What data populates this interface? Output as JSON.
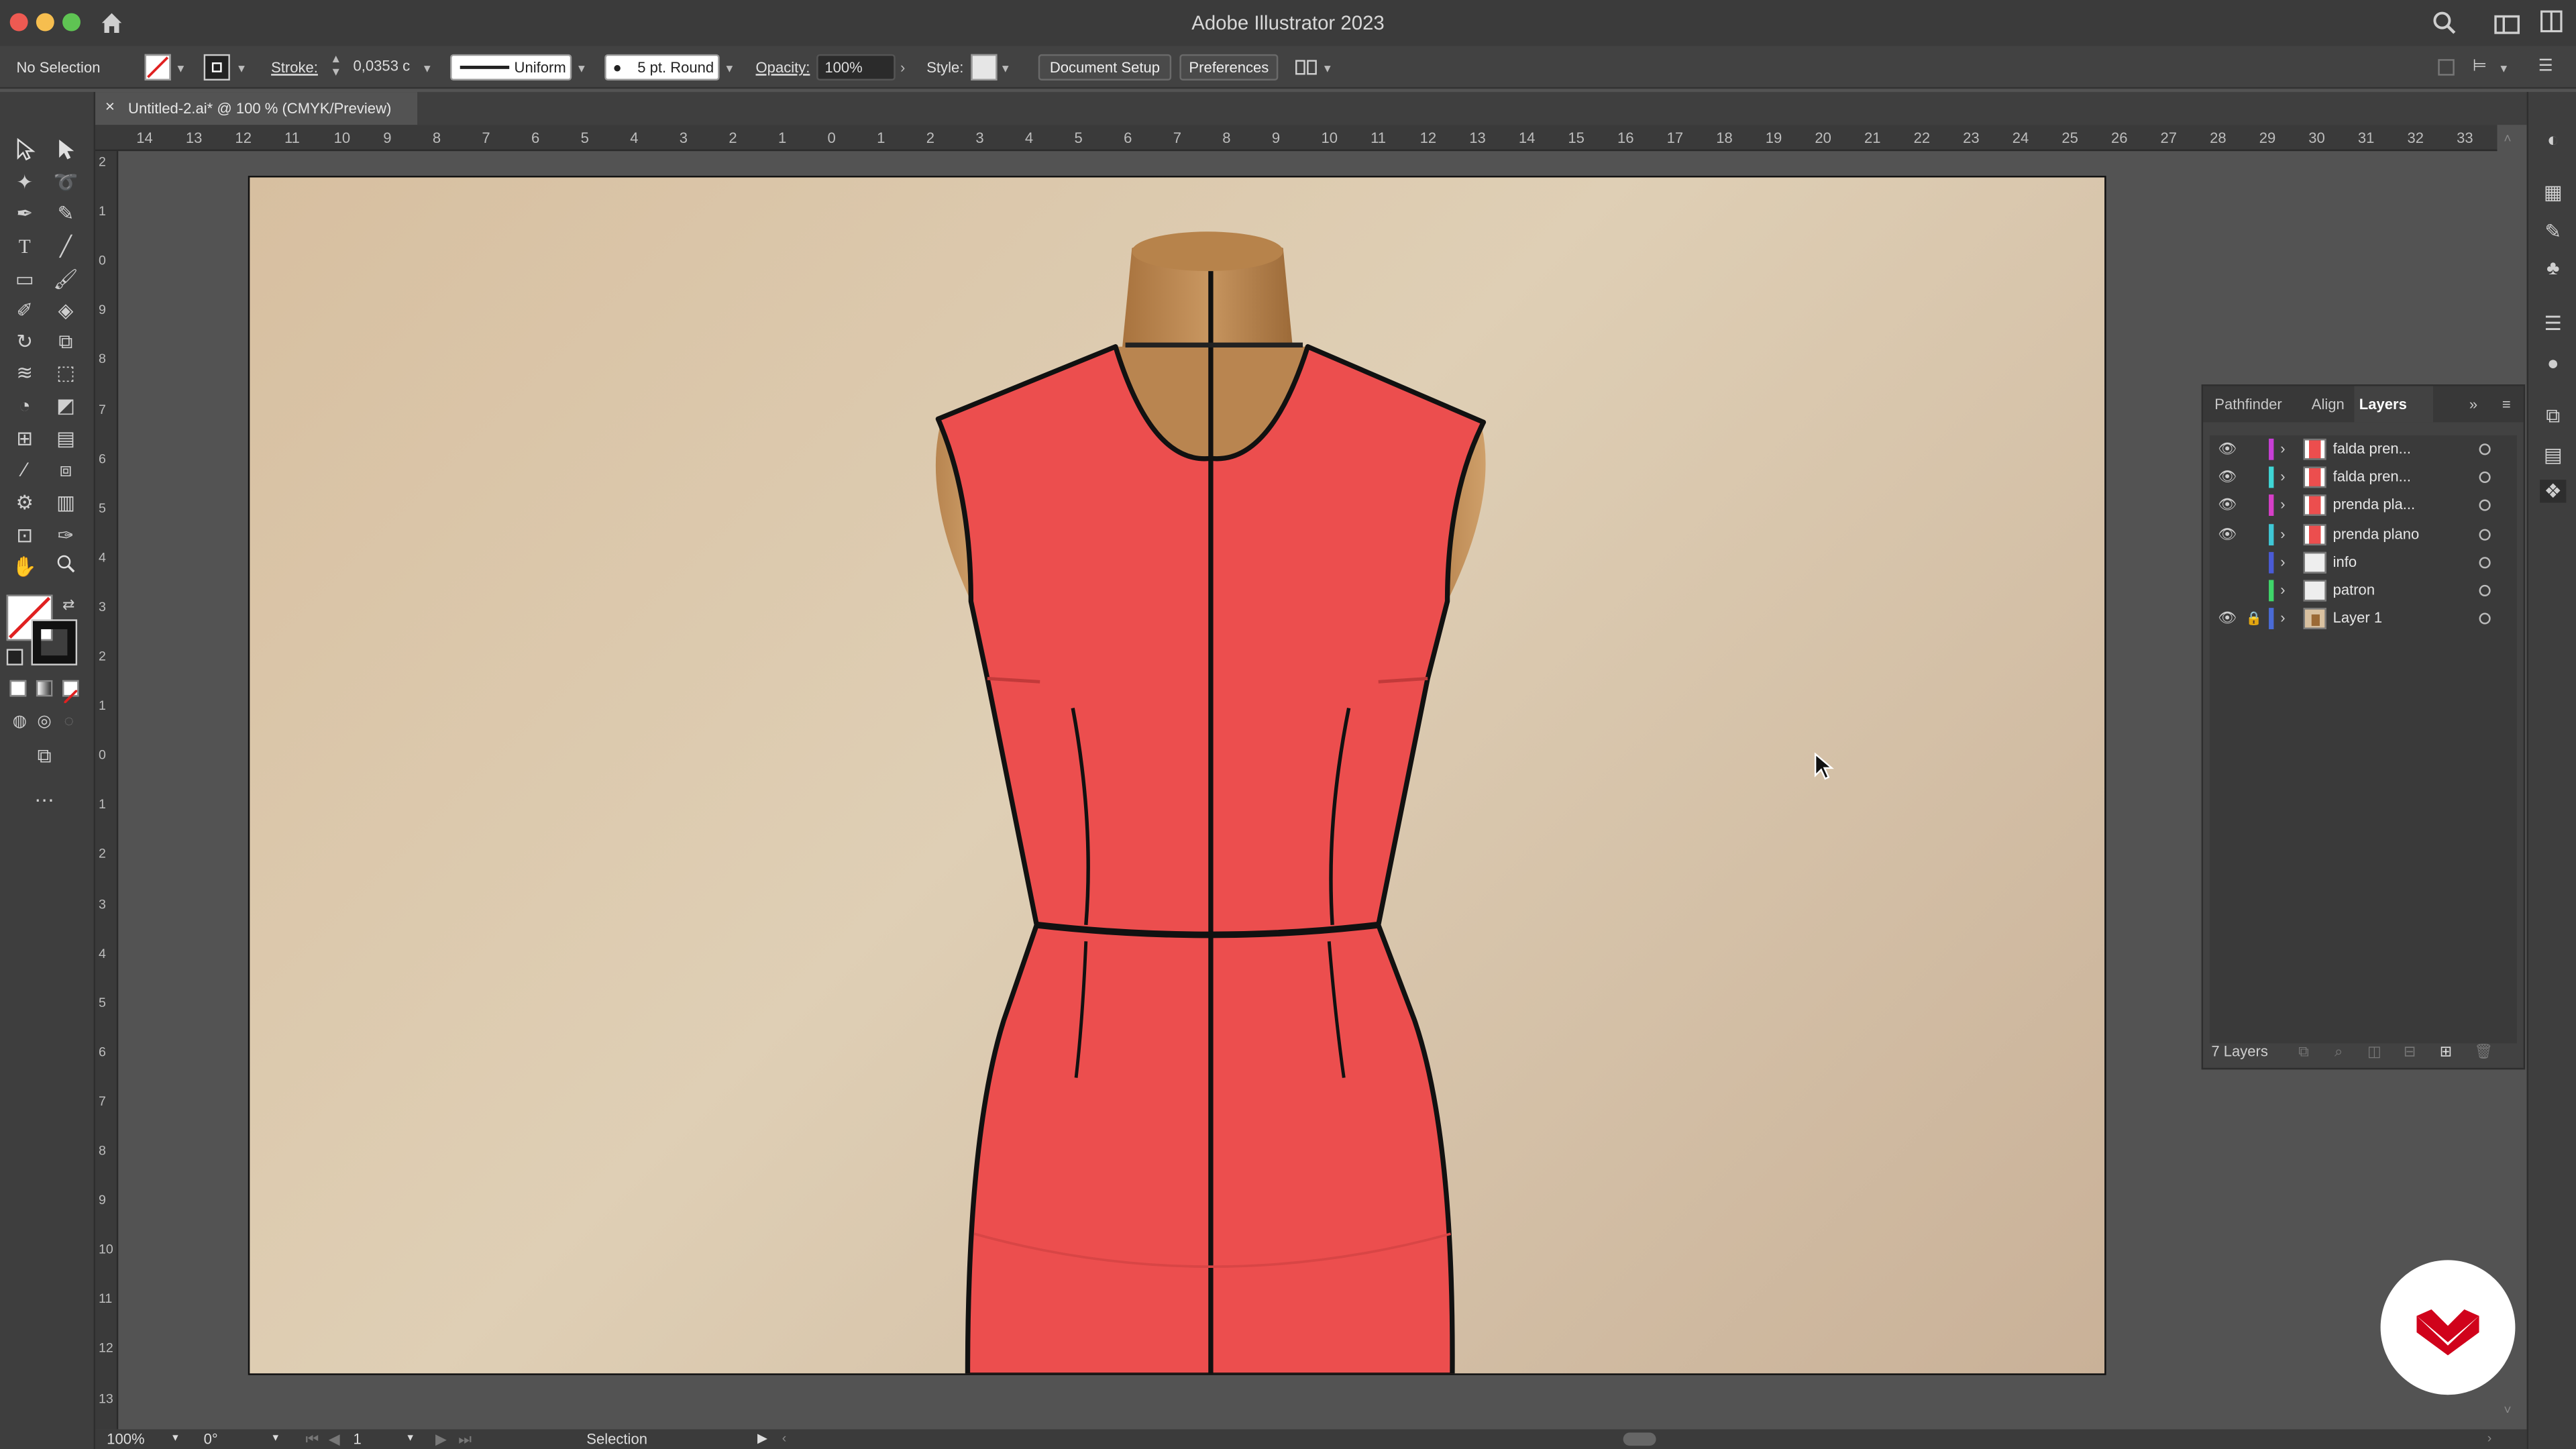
{
  "app": {
    "title": "Adobe Illustrator 2023"
  },
  "control": {
    "selection": "No Selection",
    "stroke_label": "Stroke:",
    "stroke_value": "0,0353 c",
    "profile": "Uniform",
    "brush": "5 pt. Round",
    "opacity_label": "Opacity:",
    "opacity_value": "100%",
    "style_label": "Style:",
    "doc_setup": "Document Setup",
    "preferences": "Preferences"
  },
  "document": {
    "tab_title": "Untitled-2.ai* @ 100 % (CMYK/Preview)",
    "close": "×"
  },
  "ruler": {
    "h_labels": [
      "14",
      "13",
      "12",
      "11",
      "10",
      "9",
      "8",
      "7",
      "6",
      "5",
      "4",
      "3",
      "2",
      "1",
      "0",
      "1",
      "2",
      "3",
      "4",
      "5",
      "6",
      "7",
      "8",
      "9",
      "10",
      "11",
      "12",
      "13",
      "14",
      "15",
      "16",
      "17",
      "18",
      "19",
      "20",
      "21",
      "22",
      "23",
      "24",
      "25",
      "26",
      "27",
      "28",
      "29",
      "30",
      "31",
      "32",
      "33"
    ],
    "v_labels": [
      "2",
      "1",
      "0",
      "9",
      "8",
      "7",
      "6",
      "5",
      "4",
      "3",
      "2",
      "1",
      "0",
      "1",
      "2",
      "3",
      "4",
      "5",
      "6",
      "7",
      "8",
      "9",
      "10",
      "11",
      "12",
      "13"
    ]
  },
  "panel": {
    "tabs": [
      "Pathfinder",
      "Align",
      "Layers"
    ],
    "active_tab": "Layers",
    "layers": [
      {
        "name": "falda pren...",
        "color": "#c83fd6",
        "visible": true,
        "locked": false
      },
      {
        "name": "falda pren...",
        "color": "#3fd6d6",
        "visible": true,
        "locked": false
      },
      {
        "name": "prenda pla...",
        "color": "#d63fc8",
        "visible": true,
        "locked": false
      },
      {
        "name": "prenda plano",
        "color": "#3fc8d6",
        "visible": true,
        "locked": false
      },
      {
        "name": "info",
        "color": "#4a5bd6",
        "visible": false,
        "locked": false
      },
      {
        "name": "patron",
        "color": "#3fd66a",
        "visible": false,
        "locked": false
      },
      {
        "name": "Layer 1",
        "color": "#4a6bd6",
        "visible": true,
        "locked": true
      }
    ],
    "footer": "7 Layers"
  },
  "status": {
    "zoom": "100%",
    "rotation": "0°",
    "artboard": "1",
    "tool": "Selection"
  },
  "colors": {
    "garment": "#ec4e4e",
    "brand": "#d0021b"
  }
}
